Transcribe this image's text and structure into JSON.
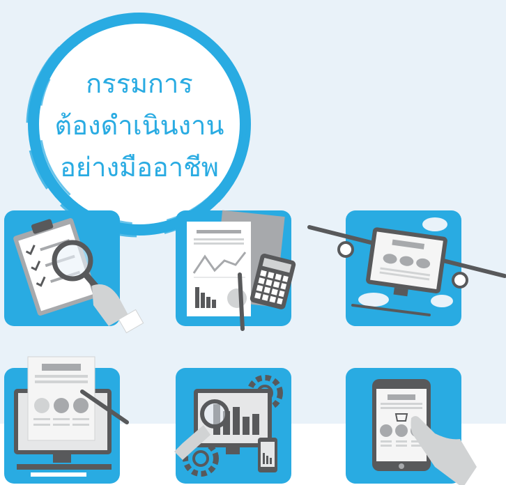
{
  "headline": {
    "line1": "กรรมการ",
    "line2": "ต้องดำเนินงาน",
    "line3": "อย่างมืออาชีพ"
  },
  "colors": {
    "brand_blue": "#29abe2",
    "light_bg": "#e9f2f9",
    "gray_dark": "#58595b",
    "gray_mid": "#a7a9ac",
    "gray_light": "#d1d3d4"
  },
  "icons": [
    "clipboard-magnifier-icon",
    "report-calculator-icon",
    "airplane-monitor-icon",
    "computer-document-pen-icon",
    "monitor-chart-gears-icon",
    "tablet-shopping-icon"
  ]
}
